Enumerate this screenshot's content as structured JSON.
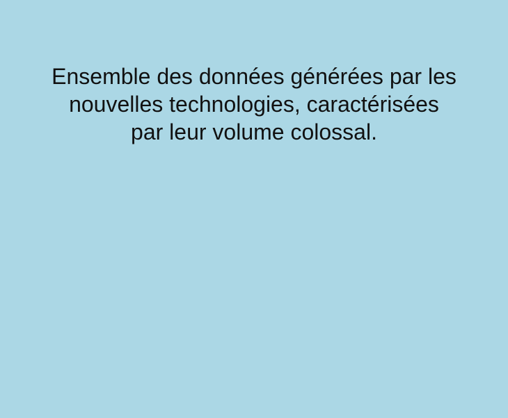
{
  "card": {
    "background_color": "#abd7e5",
    "text_color": "#111111",
    "definition_lines": [
      "Ensemble des données générées par les",
      "nouvelles technologies, caractérisées",
      "par leur volume colossal."
    ]
  }
}
